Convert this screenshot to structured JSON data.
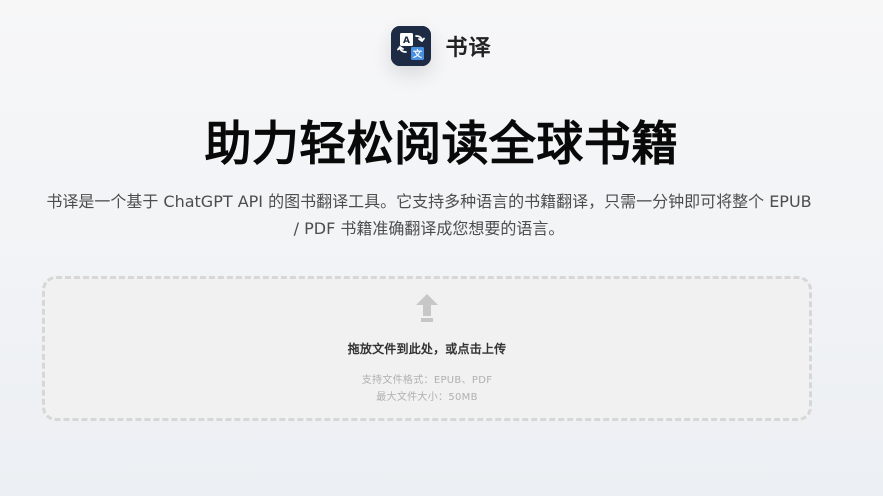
{
  "header": {
    "logo_icon": "translate-icon",
    "brand_name": "书译"
  },
  "hero": {
    "title": "助力轻松阅读全球书籍",
    "description": "书译是一个基于 ChatGPT API 的图书翻译工具。它支持多种语言的书籍翻译，只需一分钟即可将整个 EPUB / PDF 书籍准确翻译成您想要的语言。"
  },
  "upload": {
    "icon": "upload-arrow-icon",
    "main_text": "拖放文件到此处，或点击上传",
    "supported_formats": "支持文件格式：EPUB、PDF",
    "max_size": "最大文件大小：50MB"
  },
  "colors": {
    "logo_bg": "#1d2b45",
    "logo_accent": "#4a90e2",
    "title": "#090909",
    "border": "#d7d7d7"
  }
}
